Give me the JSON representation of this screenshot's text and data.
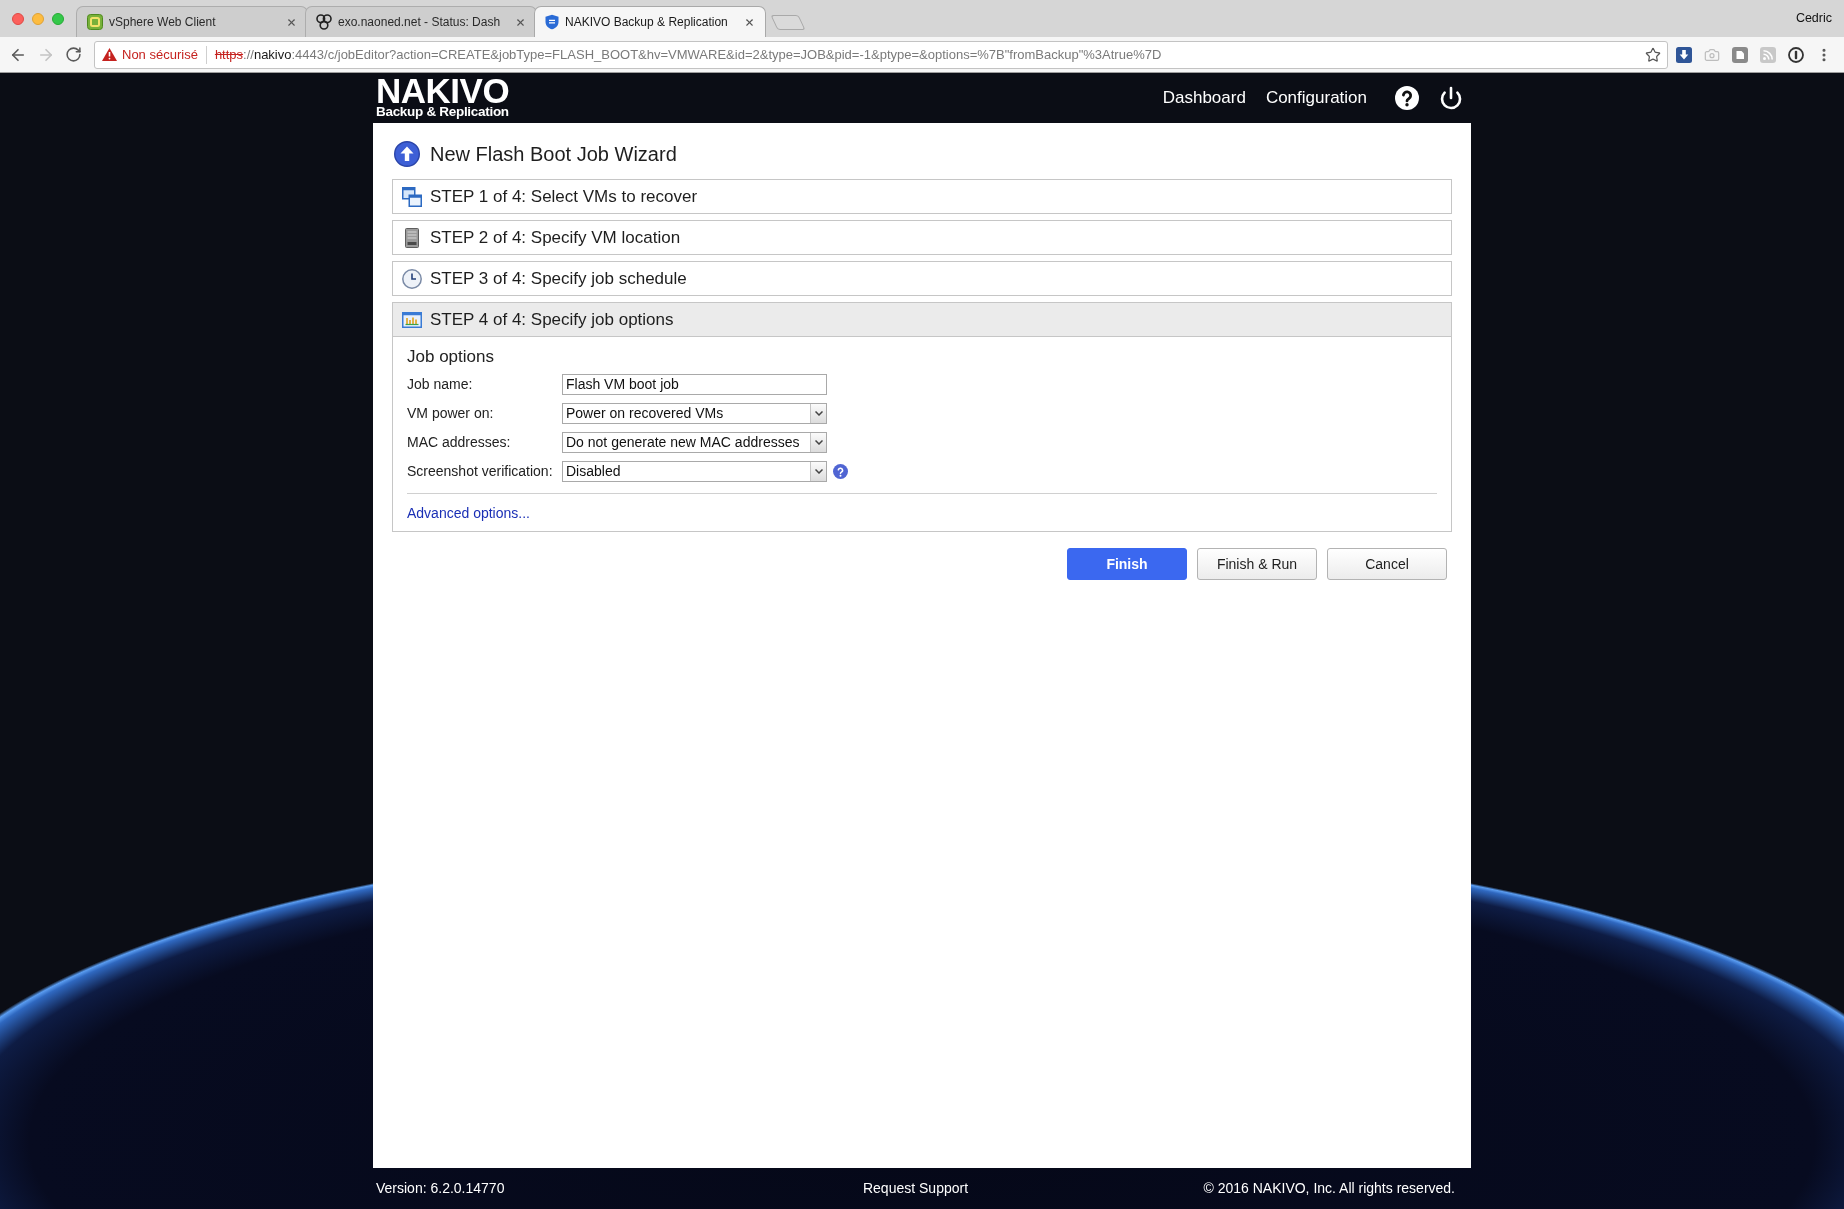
{
  "browser": {
    "tabs": [
      {
        "title": "vSphere Web Client",
        "kind": "tile",
        "selected": false
      },
      {
        "title": "exo.naoned.net - Status: Dash",
        "kind": "rings",
        "selected": false
      },
      {
        "title": "NAKIVO Backup & Replication",
        "kind": "shield",
        "selected": true
      }
    ],
    "profile": "Cedric",
    "nav_buttons": [
      {
        "kind": "back",
        "disabled": false
      },
      {
        "kind": "forward",
        "disabled": true
      },
      {
        "kind": "reload",
        "disabled": false
      }
    ],
    "security": "Non sécurisé",
    "url_parts": [
      {
        "text": "https",
        "kind": "insecure"
      },
      {
        "text": "://",
        "kind": "dim"
      },
      {
        "text": "nakivo",
        "kind": "host"
      },
      {
        "text": ":4443/c/jobEditor?action=CREATE&jobType=FLASH_BOOT&hv=VMWARE&id=2&type=JOB&pid=-1&ptype=&options=%7B\"fromBackup\"%3Atrue%7D",
        "kind": "dim"
      }
    ]
  },
  "header": {
    "logo": {
      "name": "NAKIVO",
      "tagline": "Backup & Replication"
    },
    "nav": [
      "Dashboard",
      "Configuration"
    ]
  },
  "wizard": {
    "title": "New Flash Boot Job Wizard",
    "steps": [
      {
        "label": "STEP 1 of 4: Select VMs to recover",
        "kind": "vms",
        "expanded": false
      },
      {
        "label": "STEP 2 of 4: Specify VM location",
        "kind": "server",
        "expanded": false
      },
      {
        "label": "STEP 3 of 4: Specify job schedule",
        "kind": "schedule",
        "expanded": false
      },
      {
        "label": "STEP 4 of 4: Specify job options",
        "kind": "options",
        "expanded": true,
        "body": {
          "title": "Job options",
          "fields": [
            {
              "label": "Job name:",
              "kind": "text",
              "value": "Flash VM boot job",
              "help": false
            },
            {
              "label": "VM power on:",
              "kind": "select",
              "value": "Power on recovered VMs",
              "help": false
            },
            {
              "label": "MAC addresses:",
              "kind": "select",
              "value": "Do not generate new MAC addresses",
              "help": false
            },
            {
              "label": "Screenshot verification:",
              "kind": "select",
              "value": "Disabled",
              "help": true
            }
          ],
          "link": "Advanced options..."
        }
      }
    ],
    "buttons": [
      {
        "label": "Finish",
        "kind": "primary"
      },
      {
        "label": "Finish & Run",
        "kind": "default"
      },
      {
        "label": "Cancel",
        "kind": "default"
      }
    ]
  },
  "footer": {
    "version": "Version: 6.2.0.14770",
    "support": "Request Support",
    "copyright": "© 2016 NAKIVO, Inc. All rights reserved."
  }
}
